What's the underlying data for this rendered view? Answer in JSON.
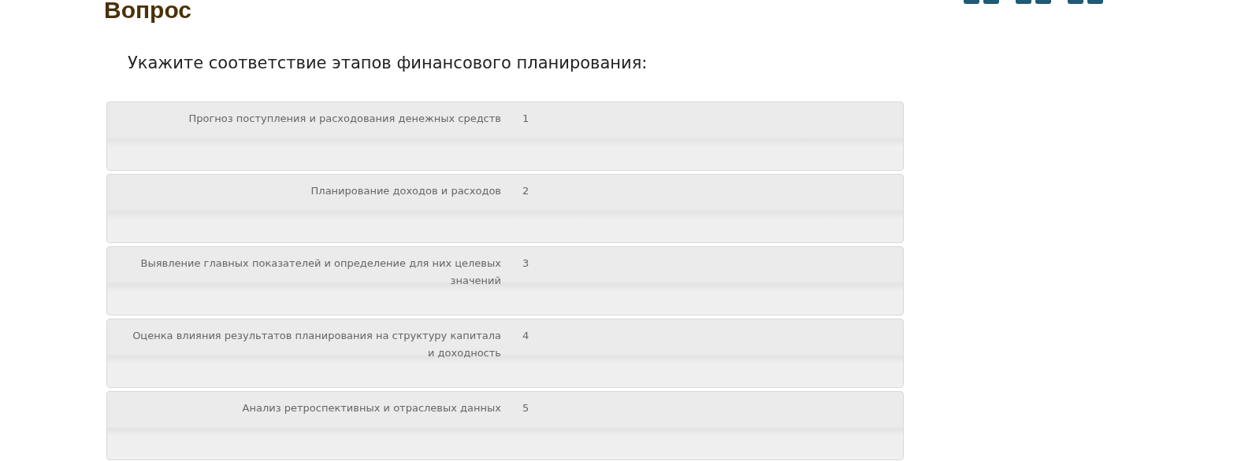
{
  "title": "Вопрос",
  "question": "Укажите соответствие этапов финансового планирования:",
  "items": [
    {
      "label": "Прогноз поступления и расходования денежных средств",
      "number": "1"
    },
    {
      "label": "Планирование доходов и расходов",
      "number": "2"
    },
    {
      "label": "Выявление главных показателей и определение для них целевых значений",
      "number": "3"
    },
    {
      "label": "Оценка влияния результатов планирования на структуру капитала и доходность",
      "number": "4"
    },
    {
      "label": "Анализ ретроспективных и отраслевых данных",
      "number": "5"
    }
  ]
}
